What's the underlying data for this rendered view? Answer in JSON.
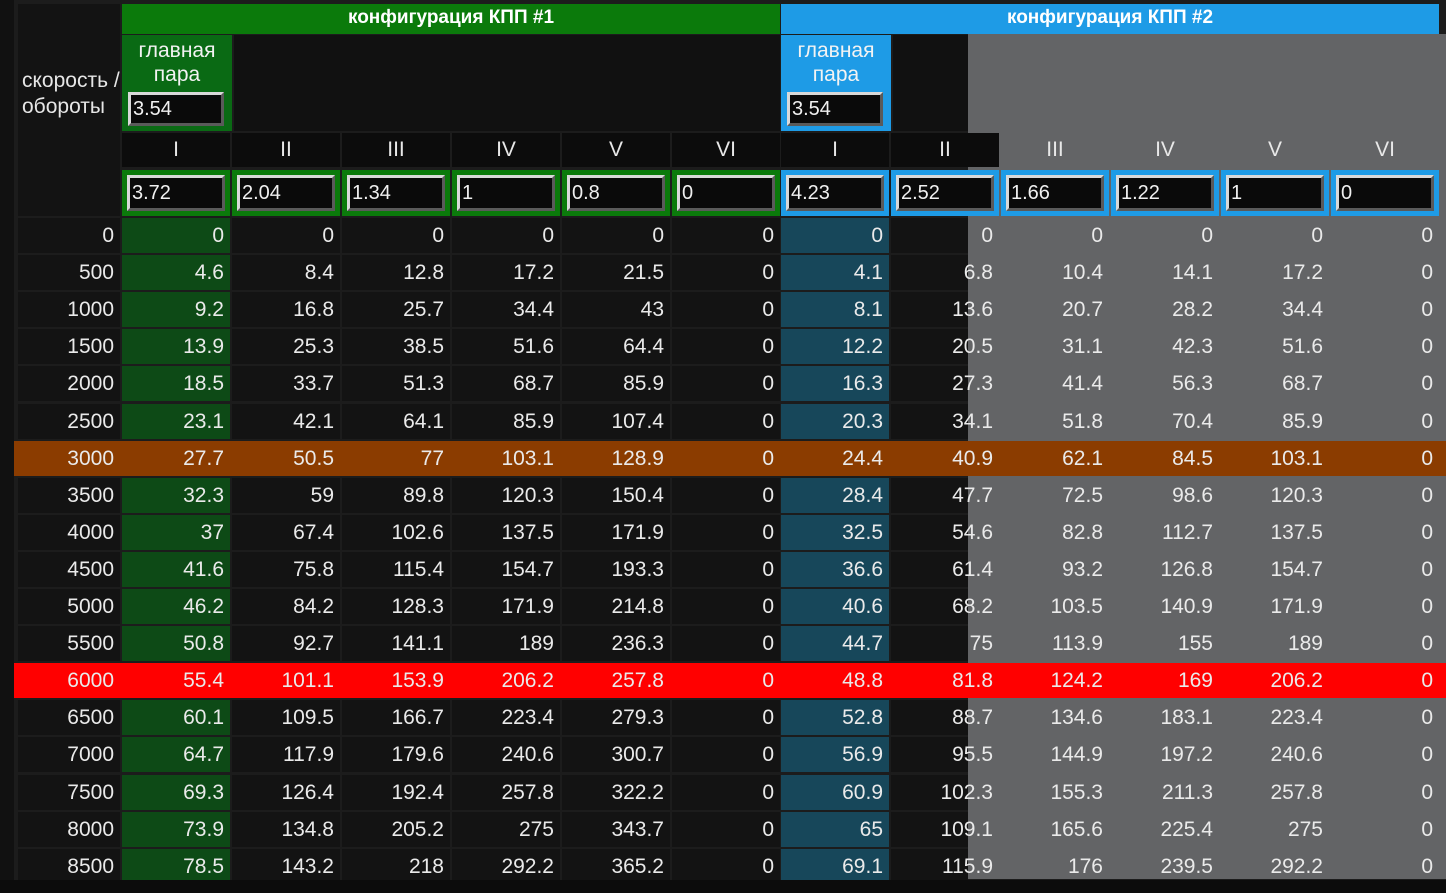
{
  "side_label": "скорость /\nобороты",
  "config1": {
    "title": "конфигурация КПП #1",
    "final_drive_label": "главная пара",
    "final_drive": "3.54",
    "gear_labels": [
      "I",
      "II",
      "III",
      "IV",
      "V",
      "VI"
    ],
    "ratios": [
      "3.72",
      "2.04",
      "1.34",
      "1",
      "0.8",
      "0"
    ],
    "accent": "#0b7a0b"
  },
  "config2": {
    "title": "конфигурация КПП #2",
    "final_drive_label": "главная пара",
    "final_drive": "3.54",
    "gear_labels": [
      "I",
      "II",
      "III",
      "IV",
      "V",
      "VI"
    ],
    "ratios": [
      "4.23",
      "2.52",
      "1.66",
      "1.22",
      "1",
      "0"
    ],
    "accent": "#1e9be6"
  },
  "rows": [
    {
      "rpm": "0",
      "c1": [
        "0",
        "0",
        "0",
        "0",
        "0",
        "0"
      ],
      "c2": [
        "0",
        "0",
        "0",
        "0",
        "0",
        "0"
      ]
    },
    {
      "rpm": "500",
      "c1": [
        "4.6",
        "8.4",
        "12.8",
        "17.2",
        "21.5",
        "0"
      ],
      "c2": [
        "4.1",
        "6.8",
        "10.4",
        "14.1",
        "17.2",
        "0"
      ]
    },
    {
      "rpm": "1000",
      "c1": [
        "9.2",
        "16.8",
        "25.7",
        "34.4",
        "43",
        "0"
      ],
      "c2": [
        "8.1",
        "13.6",
        "20.7",
        "28.2",
        "34.4",
        "0"
      ]
    },
    {
      "rpm": "1500",
      "c1": [
        "13.9",
        "25.3",
        "38.5",
        "51.6",
        "64.4",
        "0"
      ],
      "c2": [
        "12.2",
        "20.5",
        "31.1",
        "42.3",
        "51.6",
        "0"
      ]
    },
    {
      "rpm": "2000",
      "c1": [
        "18.5",
        "33.7",
        "51.3",
        "68.7",
        "85.9",
        "0"
      ],
      "c2": [
        "16.3",
        "27.3",
        "41.4",
        "56.3",
        "68.7",
        "0"
      ]
    },
    {
      "rpm": "2500",
      "c1": [
        "23.1",
        "42.1",
        "64.1",
        "85.9",
        "107.4",
        "0"
      ],
      "c2": [
        "20.3",
        "34.1",
        "51.8",
        "70.4",
        "85.9",
        "0"
      ]
    },
    {
      "rpm": "3000",
      "c1": [
        "27.7",
        "50.5",
        "77",
        "103.1",
        "128.9",
        "0"
      ],
      "c2": [
        "24.4",
        "40.9",
        "62.1",
        "84.5",
        "103.1",
        "0"
      ],
      "highlight": "orange"
    },
    {
      "rpm": "3500",
      "c1": [
        "32.3",
        "59",
        "89.8",
        "120.3",
        "150.4",
        "0"
      ],
      "c2": [
        "28.4",
        "47.7",
        "72.5",
        "98.6",
        "120.3",
        "0"
      ]
    },
    {
      "rpm": "4000",
      "c1": [
        "37",
        "67.4",
        "102.6",
        "137.5",
        "171.9",
        "0"
      ],
      "c2": [
        "32.5",
        "54.6",
        "82.8",
        "112.7",
        "137.5",
        "0"
      ]
    },
    {
      "rpm": "4500",
      "c1": [
        "41.6",
        "75.8",
        "115.4",
        "154.7",
        "193.3",
        "0"
      ],
      "c2": [
        "36.6",
        "61.4",
        "93.2",
        "126.8",
        "154.7",
        "0"
      ]
    },
    {
      "rpm": "5000",
      "c1": [
        "46.2",
        "84.2",
        "128.3",
        "171.9",
        "214.8",
        "0"
      ],
      "c2": [
        "40.6",
        "68.2",
        "103.5",
        "140.9",
        "171.9",
        "0"
      ]
    },
    {
      "rpm": "5500",
      "c1": [
        "50.8",
        "92.7",
        "141.1",
        "189",
        "236.3",
        "0"
      ],
      "c2": [
        "44.7",
        "75",
        "113.9",
        "155",
        "189",
        "0"
      ]
    },
    {
      "rpm": "6000",
      "c1": [
        "55.4",
        "101.1",
        "153.9",
        "206.2",
        "257.8",
        "0"
      ],
      "c2": [
        "48.8",
        "81.8",
        "124.2",
        "169",
        "206.2",
        "0"
      ],
      "highlight": "red"
    },
    {
      "rpm": "6500",
      "c1": [
        "60.1",
        "109.5",
        "166.7",
        "223.4",
        "279.3",
        "0"
      ],
      "c2": [
        "52.8",
        "88.7",
        "134.6",
        "183.1",
        "223.4",
        "0"
      ]
    },
    {
      "rpm": "7000",
      "c1": [
        "64.7",
        "117.9",
        "179.6",
        "240.6",
        "300.7",
        "0"
      ],
      "c2": [
        "56.9",
        "95.5",
        "144.9",
        "197.2",
        "240.6",
        "0"
      ]
    },
    {
      "rpm": "7500",
      "c1": [
        "69.3",
        "126.4",
        "192.4",
        "257.8",
        "322.2",
        "0"
      ],
      "c2": [
        "60.9",
        "102.3",
        "155.3",
        "211.3",
        "257.8",
        "0"
      ]
    },
    {
      "rpm": "8000",
      "c1": [
        "73.9",
        "134.8",
        "205.2",
        "275",
        "343.7",
        "0"
      ],
      "c2": [
        "65",
        "109.1",
        "165.6",
        "225.4",
        "275",
        "0"
      ]
    },
    {
      "rpm": "8500",
      "c1": [
        "78.5",
        "143.2",
        "218",
        "292.2",
        "365.2",
        "0"
      ],
      "c2": [
        "69.1",
        "115.9",
        "176",
        "239.5",
        "292.2",
        "0"
      ]
    }
  ],
  "colors": {
    "orange_row": "#8b3c00",
    "red_row": "#ff0000",
    "green_col": "#0d4a16",
    "blue_col": "#17475a",
    "gray_panel": "#636466",
    "cell_dark": "#131313"
  }
}
